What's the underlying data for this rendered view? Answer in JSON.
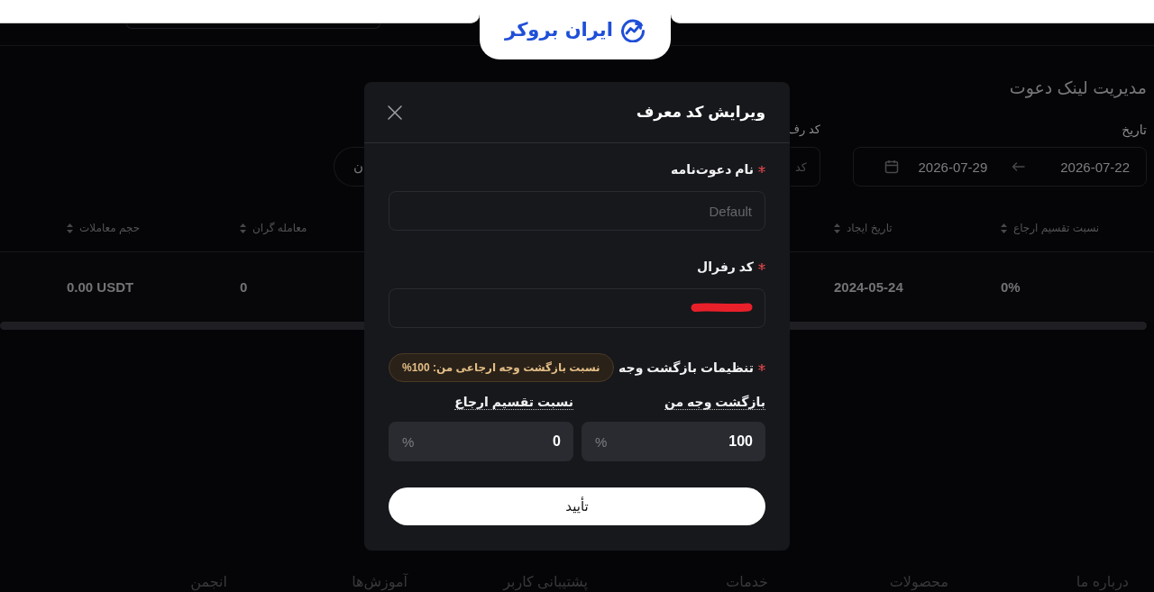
{
  "header": {
    "logo": {
      "text": "ایران بروکر"
    }
  },
  "page": {
    "title": "مدیریت لینک دعوت",
    "filters": [
      {
        "kind": "date_range",
        "label": "تاریخ",
        "start": "2026-07-22",
        "end": "2026-07-29"
      },
      {
        "kind": "text",
        "label": "کد رف",
        "placeholder": "کد"
      },
      {
        "kind": "button",
        "label": "ن"
      }
    ],
    "table": {
      "columns": [
        {
          "label": "نسبت تقسیم ارجاع"
        },
        {
          "label": "تاریخ ایجاد"
        },
        {
          "label": "معامله گران"
        },
        {
          "label": "حجم معاملات"
        }
      ],
      "rows": [
        [
          "0%",
          "2024-05-24",
          "0",
          "0.00 USDT"
        ]
      ]
    }
  },
  "footer": {
    "links": [
      "درباره ما",
      "محصولات",
      "خدمات",
      "پشتیبانی کاربر",
      "آموزش‌ها",
      "انجمن"
    ]
  },
  "modal": {
    "title": "ویرایش کد معرف",
    "fields": [
      {
        "label": "نام دعوت‌نامه",
        "required": true,
        "placeholder": "Default"
      },
      {
        "label": "کد رفرال",
        "required": true,
        "redacted": true
      }
    ],
    "commission": {
      "label": "تنظیمات بازگشت وجه",
      "required": true,
      "badge": "نسبت بازگشت وجه ارجاعی من: 100%",
      "inputs": [
        {
          "label": "بازگشت وجه من",
          "value": "100",
          "unit": "%"
        },
        {
          "label": "نسبت تقسیم ارجاع",
          "value": "0",
          "unit": "%"
        }
      ]
    },
    "submit": "تأیید"
  }
}
